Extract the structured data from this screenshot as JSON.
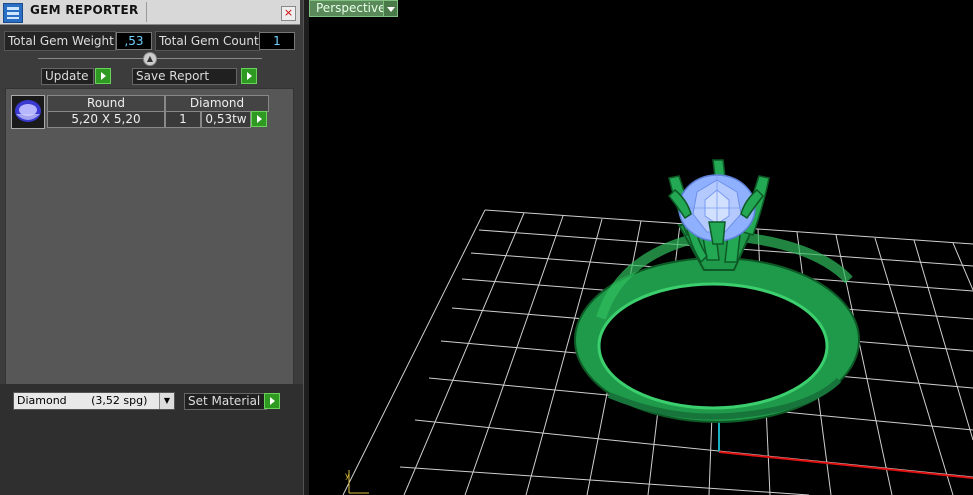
{
  "panel": {
    "title": "GEM REPORTER",
    "close_label": "×",
    "total_weight_label": "Total Gem Weight",
    "total_weight_value": ",53",
    "total_count_label": "Total Gem Count",
    "total_count_value": "1",
    "update_label": "Update",
    "save_report_label": "Save Report"
  },
  "gem_list": {
    "headers": [
      "Round",
      "Diamond"
    ],
    "rows": [
      {
        "size": "5,20 X 5,20",
        "count": "1",
        "weight": "0,53tw"
      }
    ]
  },
  "material": {
    "selected": "Diamond       (3,52 spg)",
    "set_label": "Set Material"
  },
  "viewport": {
    "view_label": "Perspective"
  },
  "colors": {
    "ring": "#1f9a4a",
    "gem": "#8fb0ff",
    "grid": "#cfcfcf",
    "x_axis": "#e01010",
    "y_axis": "#1ab0c0"
  }
}
